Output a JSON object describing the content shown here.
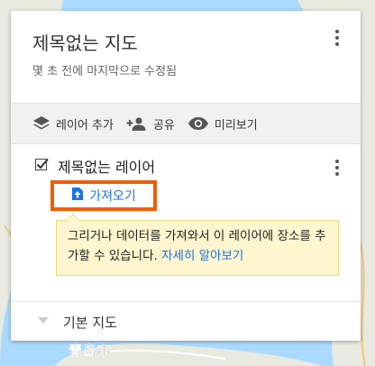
{
  "map": {
    "label": "青岛市"
  },
  "panel": {
    "title": "제목없는 지도",
    "subtitle": "몇 초 전에 마지막으로 수정됨"
  },
  "toolbar": {
    "add_layer": "레이어 추가",
    "share": "공유",
    "preview": "미리보기"
  },
  "layer": {
    "title": "제목없는 레이어",
    "checked": true,
    "import_label": "가져오기"
  },
  "tooltip": {
    "text": "그리거나 데이터를 가져와서 이 레이어에 장소를 추가할 수 있습니다. ",
    "link": "자세히 알아보기"
  },
  "basemap": {
    "label": "기본 지도"
  },
  "colors": {
    "accent": "#1a73e8",
    "highlight": "#f25c05",
    "tooltip_bg": "#fef6cf"
  }
}
